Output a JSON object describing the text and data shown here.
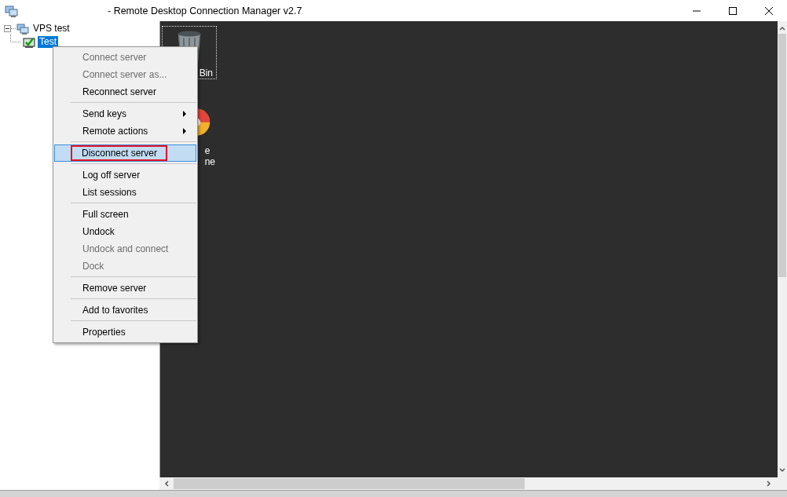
{
  "window": {
    "title": "- Remote Desktop Connection Manager v2.7"
  },
  "tree": [
    {
      "label": "VPS test",
      "expanded": true,
      "selected": false,
      "children": [
        {
          "label": "Test",
          "selected": true
        }
      ]
    }
  ],
  "remote_desktop": {
    "icons": [
      {
        "kind": "bin",
        "selected": true,
        "label_lines": [
          "Bin"
        ]
      },
      {
        "kind": "ball",
        "selected": false,
        "label_lines": [
          "e",
          "ne"
        ]
      }
    ]
  },
  "context_menu": {
    "items": [
      {
        "kind": "item",
        "label": "Connect server",
        "disabled": true,
        "submenu": false,
        "highlighted": false,
        "annotated": false
      },
      {
        "kind": "item",
        "label": "Connect server as...",
        "disabled": true,
        "submenu": false,
        "highlighted": false,
        "annotated": false
      },
      {
        "kind": "item",
        "label": "Reconnect server",
        "disabled": false,
        "submenu": false,
        "highlighted": false,
        "annotated": false
      },
      {
        "kind": "separator"
      },
      {
        "kind": "item",
        "label": "Send keys",
        "disabled": false,
        "submenu": true,
        "highlighted": false,
        "annotated": false
      },
      {
        "kind": "item",
        "label": "Remote actions",
        "disabled": false,
        "submenu": true,
        "highlighted": false,
        "annotated": false
      },
      {
        "kind": "separator"
      },
      {
        "kind": "item",
        "label": "Disconnect server",
        "disabled": false,
        "submenu": false,
        "highlighted": true,
        "annotated": true
      },
      {
        "kind": "separator"
      },
      {
        "kind": "item",
        "label": "Log off server",
        "disabled": false,
        "submenu": false,
        "highlighted": false,
        "annotated": false
      },
      {
        "kind": "item",
        "label": "List sessions",
        "disabled": false,
        "submenu": false,
        "highlighted": false,
        "annotated": false
      },
      {
        "kind": "separator"
      },
      {
        "kind": "item",
        "label": "Full screen",
        "disabled": false,
        "submenu": false,
        "highlighted": false,
        "annotated": false
      },
      {
        "kind": "item",
        "label": "Undock",
        "disabled": false,
        "submenu": false,
        "highlighted": false,
        "annotated": false
      },
      {
        "kind": "item",
        "label": "Undock and connect",
        "disabled": true,
        "submenu": false,
        "highlighted": false,
        "annotated": false
      },
      {
        "kind": "item",
        "label": "Dock",
        "disabled": true,
        "submenu": false,
        "highlighted": false,
        "annotated": false
      },
      {
        "kind": "separator"
      },
      {
        "kind": "item",
        "label": "Remove server",
        "disabled": false,
        "submenu": false,
        "highlighted": false,
        "annotated": false
      },
      {
        "kind": "separator"
      },
      {
        "kind": "item",
        "label": "Add to favorites",
        "disabled": false,
        "submenu": false,
        "highlighted": false,
        "annotated": false
      },
      {
        "kind": "separator"
      },
      {
        "kind": "item",
        "label": "Properties",
        "disabled": false,
        "submenu": false,
        "highlighted": false,
        "annotated": false
      }
    ]
  }
}
